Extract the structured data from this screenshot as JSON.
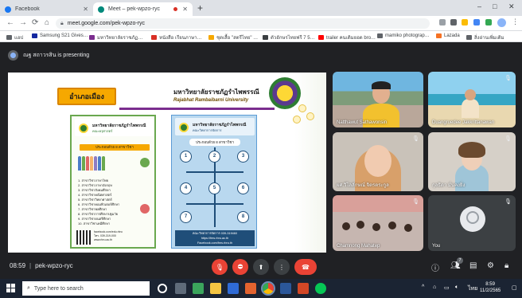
{
  "browser": {
    "tabs": [
      {
        "label": "Facebook",
        "favicon_color": "#1877f2"
      },
      {
        "label": "Meet – pek-wpzo-ryc",
        "favicon_color": "#00897b",
        "active": true
      }
    ],
    "url": "meet.google.com/pek-wpzo-ryc",
    "bookmarks": [
      {
        "label": "แอป",
        "color": "#5f6368"
      },
      {
        "label": "Samsung S21 Gives…",
        "color": "#1428a0"
      },
      {
        "label": "มหาวิทยาลัยราชภัฏ…",
        "color": "#7b2d8e"
      },
      {
        "label": "หนังสือ เรียนภาษา…",
        "color": "#d93025"
      },
      {
        "label": "ชุดเสื้อ \"สตรีไทย\" …",
        "color": "#f6a800"
      },
      {
        "label": "ตัวอักษรไทยฟรี 7 5…",
        "color": "#3c4043"
      },
      {
        "label": "trailer คนเดิมยอด bro…",
        "color": "#ff0000"
      },
      {
        "label": "mamiko photograp…",
        "color": "#5f6368"
      },
      {
        "label": "Lazada",
        "color": "#f57224"
      },
      {
        "label": "สิ่งอ่านเพิ่มเติม",
        "color": "#5f6368"
      }
    ],
    "window_controls": [
      "–",
      "□",
      "✕"
    ]
  },
  "meet": {
    "presenting_text": "ณฐ สถาวรสิน is presenting",
    "time": "08:59",
    "meeting_code": "pek-wpzo-ryc",
    "participants_badge": "7",
    "participants": [
      {
        "name": "Natthawut Sathawonsin",
        "muted": false
      },
      {
        "name": "Duangruedee Jakkrittanawan",
        "muted": true
      },
      {
        "name": "ผศ.วิไลลักษณ์ จิตรตระกูล",
        "muted": true
      },
      {
        "name": "กุลธิดา มั่นคงยิ่ง",
        "muted": true
      },
      {
        "name": "Chamnong Mahatep",
        "muted": true
      },
      {
        "name": "You",
        "muted": true
      }
    ],
    "controls": {
      "mic_icon": "mic-off-icon",
      "cam_icon": "camera-off-icon",
      "present_icon": "present-icon",
      "more_icon": "more-icon",
      "end_icon": "end-call-icon"
    }
  },
  "slide": {
    "district_label": "อำเภอเมือง",
    "university_name": "มหาวิทยาลัยราชภัฏรำไพพรรณี",
    "university_en": "Rajabhat Rambaibarni University",
    "poster_left": {
      "title": "มหาวิทยาลัยราชภัฏรำไพพรรณี",
      "subtitle": "คณะครุศาสตร์",
      "band": "ประกอบด้วย 8 สาขาวิชา",
      "programs": [
        "1. สาขาวิชาภาษาไทย",
        "2. สาขาวิชาภาษาอังกฤษ",
        "3. สาขาวิชาสังคมศึกษา",
        "4. สาขาวิชาคณิตศาสตร์",
        "5. สาขาวิชาวิทยาศาสตร์",
        "6. สาขาวิชาคอมพิวเตอร์ศึกษา",
        "7. สาขาวิชาพลศึกษา",
        "8. สาขาวิชาการศึกษาปฐมวัย",
        "9. สาขาวิชาดนตรีศึกษา",
        "10. สาขาวิชาเคมีศึกษา"
      ],
      "contact_lines": [
        "facebook.com/edu.rbru",
        "โทร. 039-319-000",
        "www.rbru.ac.th"
      ]
    },
    "poster_right": {
      "title": "มหาวิทยาลัยราชภัฏรำไพพรรณี",
      "subtitle": "คณะวิทยาการจัดการ",
      "band": "ประกอบด้วย 8 สาขาวิชา",
      "nodes": [
        "1",
        "2",
        "3",
        "4",
        "5",
        "6",
        "7",
        "8"
      ],
      "contact_lines": [
        "คณะวิทยาการจัดการ 039-319460",
        "https://fms.rbru.ac.th",
        "Facebook.com/fms.rbru.th"
      ]
    }
  },
  "taskbar": {
    "search_placeholder": "Type here to search",
    "time": "8:59",
    "date": "11/2/2565",
    "lang": "ไทย"
  }
}
